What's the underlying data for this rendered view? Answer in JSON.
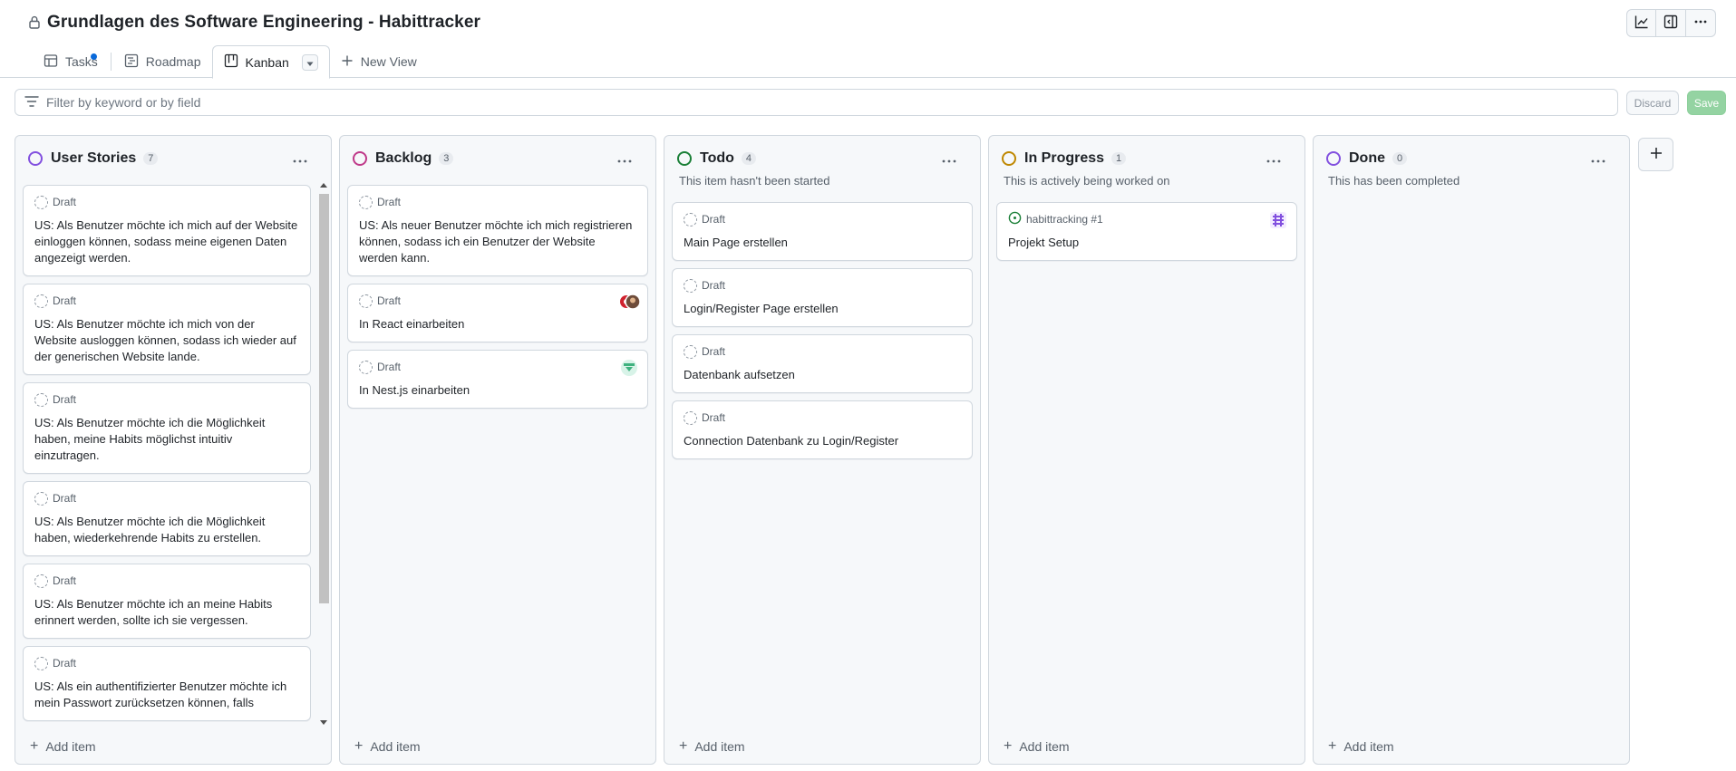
{
  "header": {
    "title": "Grundlagen des Software Engineering - Habittracker",
    "icons": [
      "lock-icon",
      "insights-icon",
      "side-panel-icon",
      "kebab-horizontal-icon"
    ]
  },
  "tabs": [
    {
      "label": "Tasks",
      "icon": "table-icon",
      "active": false
    },
    {
      "label": "Roadmap",
      "icon": "roadmap-icon",
      "active": false
    },
    {
      "label": "Kanban",
      "icon": "board-icon",
      "active": true
    },
    {
      "label": "New View",
      "icon": "plus-icon",
      "active": false
    }
  ],
  "filter": {
    "placeholder": "Filter by keyword or by field",
    "discard_label": "Discard",
    "save_label": "Save"
  },
  "columns": [
    {
      "title": "User Stories",
      "count": "7",
      "color": "#8250df",
      "description": "",
      "add_label": "Add item",
      "cards": [
        {
          "meta": "Draft",
          "text": "US: Als Benutzer möchte ich mich auf der Website einloggen können, sodass meine eigenen Daten angezeigt werden."
        },
        {
          "meta": "Draft",
          "text": "US: Als Benutzer möchte ich mich von der Website ausloggen können, sodass ich wieder auf der generischen Website lande."
        },
        {
          "meta": "Draft",
          "text": "US: Als Benutzer möchte ich die Möglichkeit haben, meine Habits möglichst intuitiv einzutragen."
        },
        {
          "meta": "Draft",
          "text": "US: Als Benutzer möchte ich die Möglichkeit haben, wiederkehrende Habits zu erstellen."
        },
        {
          "meta": "Draft",
          "text": "US: Als Benutzer möchte ich an meine Habits erinnert werden, sollte ich sie vergessen."
        },
        {
          "meta": "Draft",
          "text": "US: Als ein authentifizierter Benutzer möchte ich mein Passwort zurücksetzen können, falls"
        }
      ]
    },
    {
      "title": "Backlog",
      "count": "3",
      "color": "#bf3989",
      "description": "",
      "add_label": "Add item",
      "cards": [
        {
          "meta": "Draft",
          "text": "US: Als neuer Benutzer möchte ich mich registrieren können, sodass ich ein Benutzer der Website werden kann."
        },
        {
          "meta": "Draft",
          "text": "In React einarbeiten"
        },
        {
          "meta": "Draft",
          "text": "In Nest.js einarbeiten"
        }
      ]
    },
    {
      "title": "Todo",
      "count": "4",
      "color": "#1a7f37",
      "description": "This item hasn't been started",
      "add_label": "Add item",
      "cards": [
        {
          "meta": "Draft",
          "text": "Main Page erstellen"
        },
        {
          "meta": "Draft",
          "text": "Login/Register Page erstellen"
        },
        {
          "meta": "Draft",
          "text": "Datenbank aufsetzen"
        },
        {
          "meta": "Draft",
          "text": "Connection Datenbank zu Login/Register"
        }
      ]
    },
    {
      "title": "In Progress",
      "count": "1",
      "color": "#bf8700",
      "description": "This is actively being worked on",
      "add_label": "Add item",
      "cards": [
        {
          "meta": "habittracking #1",
          "text": "Projekt Setup"
        }
      ]
    },
    {
      "title": "Done",
      "count": "0",
      "color": "#8250df",
      "description": "This has been completed",
      "add_label": "Add item",
      "cards": []
    }
  ],
  "colors": {
    "accent_blue": "#0969da",
    "save_green": "#94d3a2",
    "open_issue_green": "#1a7f37"
  }
}
